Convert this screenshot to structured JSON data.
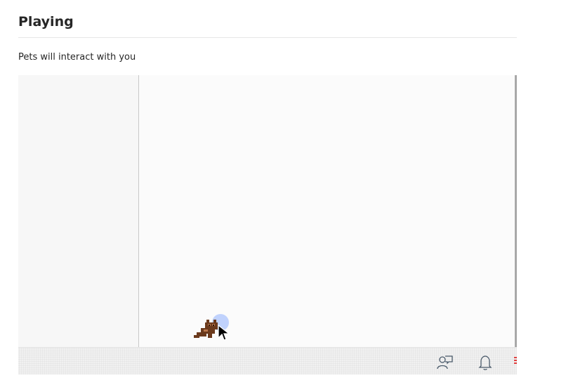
{
  "section": {
    "title": "Playing",
    "description": "Pets will interact with you"
  },
  "preview": {
    "taskbar": {
      "icons": [
        "feedback-icon",
        "notification-bell-icon"
      ]
    },
    "pet": "cat-pet-icon",
    "cursor": "mouse-pointer-icon"
  },
  "colors": {
    "accent_halo": "#78a0ff",
    "taskbar_bg": "#f1f1f1"
  }
}
